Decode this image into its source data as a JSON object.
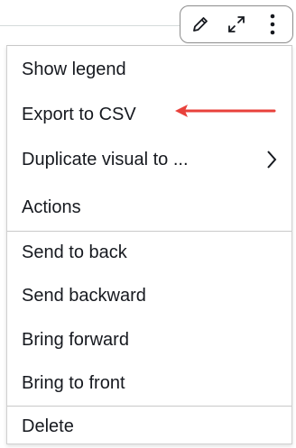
{
  "toolbar": {
    "icons": [
      "pencil-icon",
      "expand-icon",
      "more-vertical-icon"
    ]
  },
  "menu": {
    "items": [
      {
        "label": "Show legend"
      },
      {
        "label": "Export to CSV",
        "highlighted_by_arrow": true
      },
      {
        "label": "Duplicate visual to ...",
        "has_submenu": true
      },
      {
        "label": "Actions"
      },
      {
        "label": "Send to back"
      },
      {
        "label": "Send backward"
      },
      {
        "label": "Bring forward"
      },
      {
        "label": "Bring to front"
      },
      {
        "label": "Delete"
      }
    ]
  },
  "colors": {
    "arrow": "#e8413b",
    "text": "#16191f",
    "border": "#c9c9c9"
  }
}
